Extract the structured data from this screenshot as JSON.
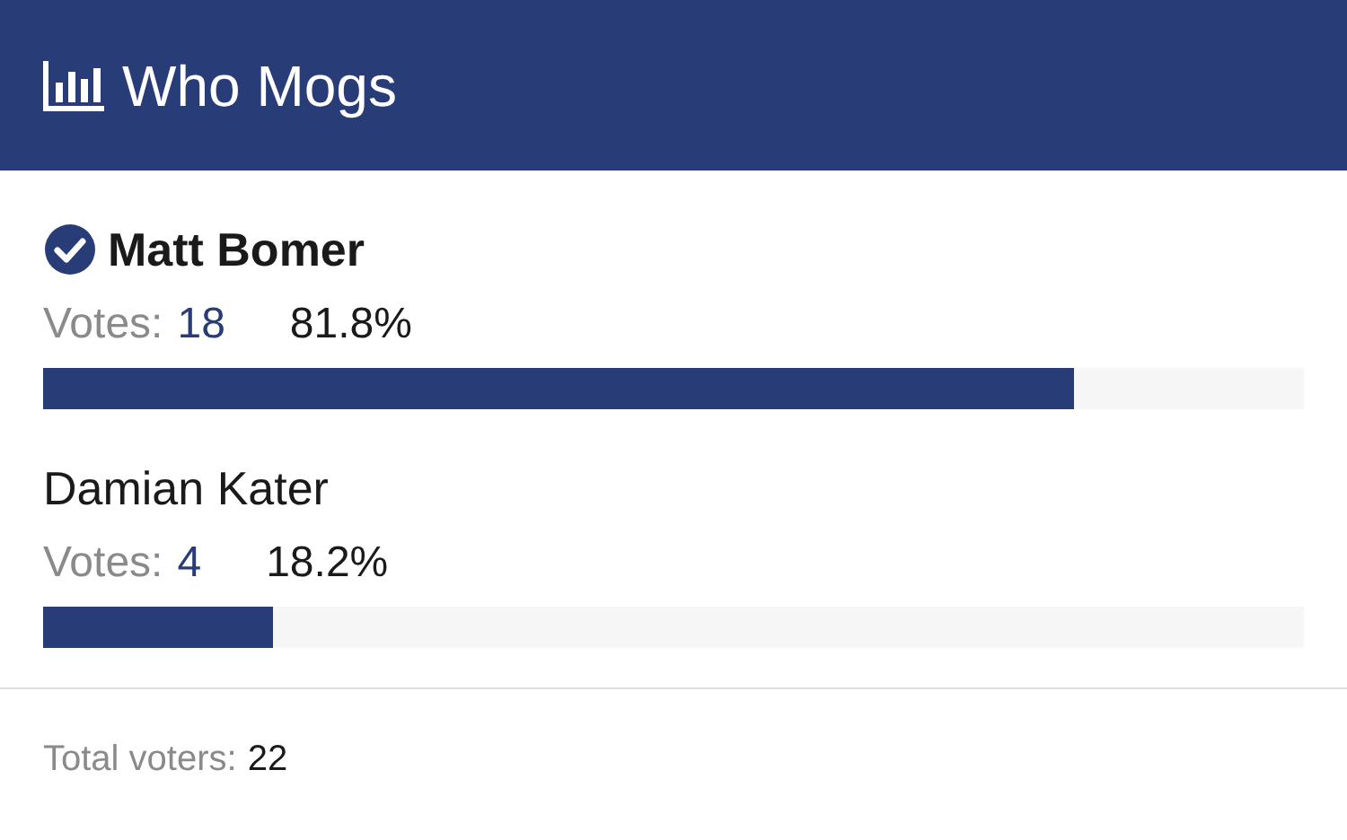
{
  "header": {
    "title": "Who Mogs"
  },
  "options": [
    {
      "name": "Matt Bomer",
      "selected": true,
      "votes_label": "Votes:",
      "votes": "18",
      "percent": "81.8%",
      "level": 0.818
    },
    {
      "name": "Damian Kater",
      "selected": false,
      "votes_label": "Votes:",
      "votes": "4",
      "percent": "18.2%",
      "level": 0.182
    }
  ],
  "footer": {
    "label": "Total voters:",
    "value": "22"
  }
}
